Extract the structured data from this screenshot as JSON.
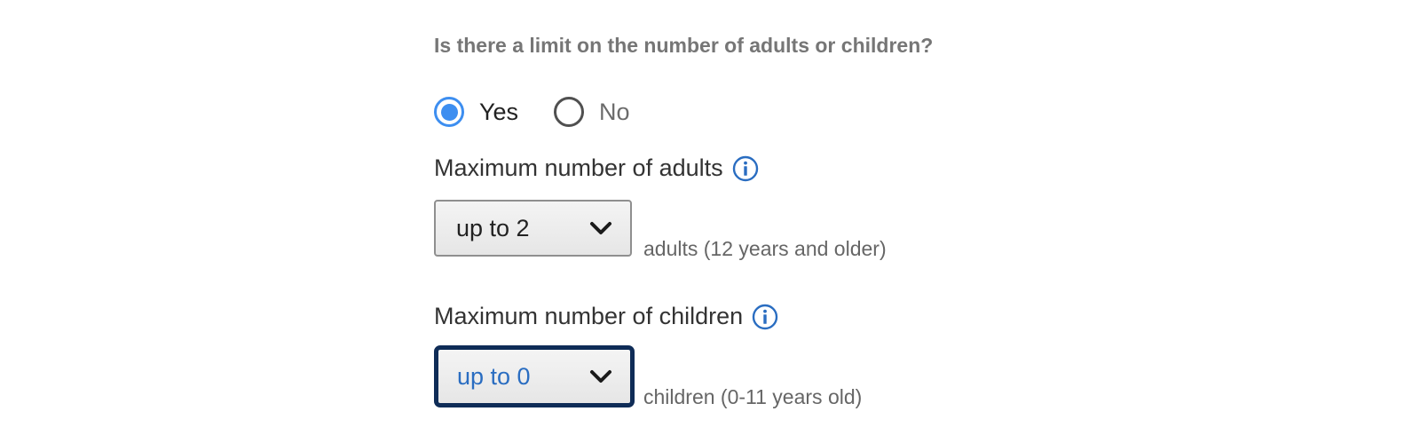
{
  "question": "Is there a limit on the number of adults or children?",
  "limit_options": [
    {
      "label": "Yes",
      "selected": true
    },
    {
      "label": "No",
      "selected": false
    }
  ],
  "adults": {
    "label": "Maximum number of adults",
    "value": "up to 2",
    "unit": "adults (12 years and older)"
  },
  "children": {
    "label": "Maximum number of children",
    "value": "up to 0",
    "unit": "children (0-11 years old)"
  },
  "colors": {
    "accent": "#3d8ef0",
    "info": "#2a6dc1",
    "focus_border": "#0f2c57"
  }
}
